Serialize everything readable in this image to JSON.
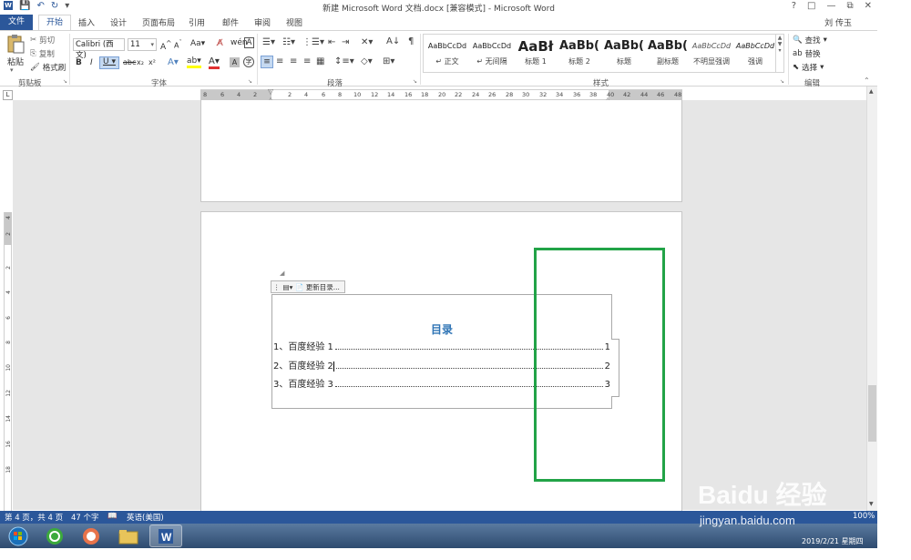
{
  "window": {
    "title": "新建 Microsoft Word 文档.docx [兼容模式] - Microsoft Word",
    "user": "刘 传玉",
    "controls": [
      "?",
      "□",
      "—",
      "⧉",
      "✕"
    ]
  },
  "tabs": {
    "file": "文件",
    "home": "开始",
    "items": [
      "插入",
      "设计",
      "页面布局",
      "引用",
      "邮件",
      "审阅",
      "视图"
    ]
  },
  "ribbon": {
    "clipboard": {
      "paste": "粘贴",
      "cut": "剪切",
      "copy": "复制",
      "format_painter": "格式刷",
      "label": "剪贴板"
    },
    "font": {
      "name": "Calibri (西文)",
      "size": "11",
      "label": "字体"
    },
    "paragraph": {
      "label": "段落"
    },
    "styles": {
      "label": "样式",
      "items": [
        {
          "sample": "AaBbCcDd",
          "name": "↵ 正文"
        },
        {
          "sample": "AaBbCcDd",
          "name": "↵ 无间隔"
        },
        {
          "sample": "AaBł",
          "name": "标题 1"
        },
        {
          "sample": "AaBb(",
          "name": "标题 2"
        },
        {
          "sample": "AaBb(",
          "name": "标题"
        },
        {
          "sample": "AaBb(",
          "name": "副标题"
        },
        {
          "sample": "AaBbCcDd",
          "name": "不明显强调"
        },
        {
          "sample": "AaBbCcDd",
          "name": "强调"
        }
      ]
    },
    "editing": {
      "find": "查找",
      "replace": "替换",
      "select": "选择",
      "label": "编辑"
    }
  },
  "ruler": {
    "left_ticks": [
      "8",
      "6",
      "4",
      "2"
    ],
    "right_ticks": [
      "2",
      "4",
      "6",
      "8",
      "10",
      "12",
      "14",
      "16",
      "18",
      "20",
      "22",
      "24",
      "26",
      "28",
      "30",
      "32",
      "34",
      "36",
      "38",
      "40",
      "42",
      "44",
      "46",
      "48"
    ],
    "vertical_ticks": [
      "4",
      "2",
      "2",
      "4",
      "6",
      "8",
      "10",
      "12",
      "14",
      "16",
      "18"
    ]
  },
  "document": {
    "toc_toolbar": {
      "update_label": "更新目录..."
    },
    "toc_title": "目录",
    "toc_entries": [
      {
        "num": "1、",
        "text": "百度经验 1",
        "page": "1"
      },
      {
        "num": "2、",
        "text": "百度经验 2",
        "page": "2"
      },
      {
        "num": "3、",
        "text": "百度经验 3",
        "page": "3"
      }
    ]
  },
  "status": {
    "page": "第 4 页，共 4 页",
    "words": "47 个字",
    "language": "英语(美国)",
    "zoom": "100%"
  },
  "taskbar": {
    "datetime": "2019/2/21 星期四"
  },
  "watermark": {
    "brand": "Baidu 经验",
    "url": "jingyan.baidu.com"
  },
  "colors": {
    "accent": "#2b579a",
    "highlight": "#22a347",
    "toc_title": "#2e74b5"
  }
}
